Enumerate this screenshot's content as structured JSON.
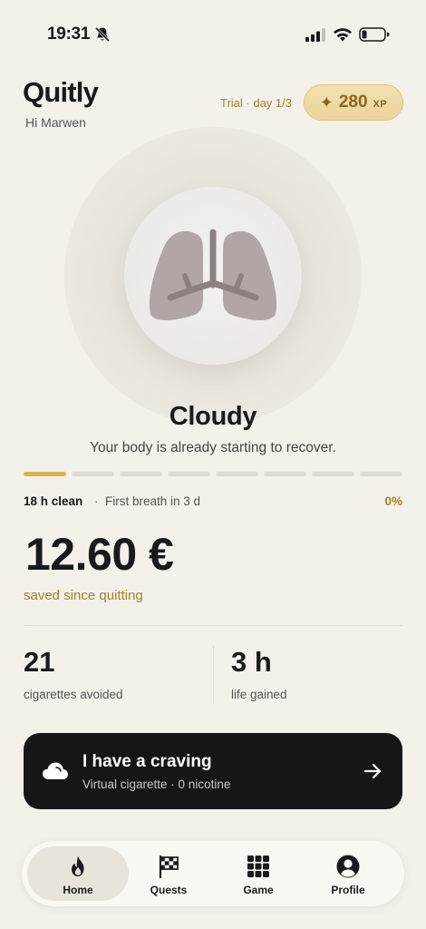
{
  "status_bar": {
    "time": "19:31"
  },
  "header": {
    "app_title": "Quitly",
    "greeting": "Hi Marwen",
    "trial": "Trial · day 1/3",
    "xp": {
      "icon": "sparkle-icon",
      "value": "280",
      "unit": "XP"
    }
  },
  "health": {
    "icon": "lungs-icon",
    "state_title": "Cloudy",
    "state_subtitle": "Your body is already starting to recover.",
    "progress_segments": 8,
    "progress_active": 1
  },
  "progress_row": {
    "clean": "18 h clean",
    "separator": "·",
    "next_milestone": "First breath in 3 d",
    "percent": "0%"
  },
  "savings": {
    "amount": "12.60 €",
    "label": "saved since quitting"
  },
  "stats": [
    {
      "value": "21",
      "label": "cigarettes avoided"
    },
    {
      "value": "3 h",
      "label": "life gained"
    }
  ],
  "craving_button": {
    "icon": "cloud-icon",
    "title": "I have a craving",
    "subtitle": "Virtual cigarette · 0 nicotine",
    "arrow_icon": "arrow-right-icon"
  },
  "nav": {
    "items": [
      {
        "label": "Home",
        "icon": "flame-icon",
        "active": true
      },
      {
        "label": "Quests",
        "icon": "checkered-flag-icon",
        "active": false
      },
      {
        "label": "Game",
        "icon": "grid-icon",
        "active": false
      },
      {
        "label": "Profile",
        "icon": "user-icon",
        "active": false
      }
    ]
  },
  "colors": {
    "accent_gold": "#a6802e",
    "progress_gold": "#d9b552",
    "background": "#f4f1ea",
    "card_dark": "#161616"
  }
}
